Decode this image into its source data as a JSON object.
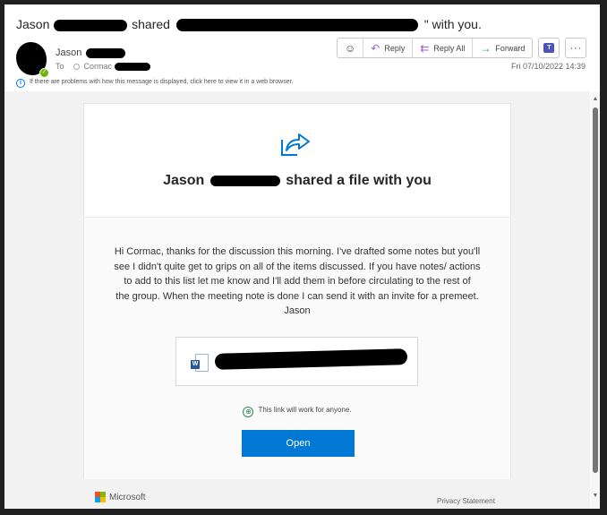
{
  "email": {
    "subject_prefix": "Jason",
    "subject_mid": "shared",
    "subject_suffix": "\" with you.",
    "sender_name": "Jason",
    "to_label": "To",
    "recipient": "Cormac",
    "info_bar": "If there are problems with how this message is displayed, click here to view it in a web browser.",
    "date": "Fri 07/10/2022 14:39",
    "presence": "available"
  },
  "toolbar": {
    "emoji_icon": "☺",
    "reply_icon": "↶",
    "reply_label": "Reply",
    "reply_all_icon": "⇇",
    "reply_all_label": "Reply All",
    "forward_icon": "→",
    "forward_label": "Forward",
    "teams_icon": "T",
    "more_icon": "···"
  },
  "card": {
    "title_prefix": "Jason",
    "title_suffix": "shared a file with you",
    "message_lines": [
      "Hi Cormac, thanks for the discussion this morning. I've drafted some notes but you'll",
      "see I didn't quite get to grips on all of the items discussed. If you have notes/ actions",
      "to add to this list let me know and I'll add them in before circulating to the rest of",
      "the group. When the meeting note is done I can send it with an invite for a premeet.",
      "Jason"
    ],
    "file_type": "W",
    "link_note": "This link will work for anyone.",
    "open_label": "Open"
  },
  "footer": {
    "brand": "Microsoft",
    "privacy": "Privacy Statement",
    "logo_colors": [
      "#f25022",
      "#7fba00",
      "#00a4ef",
      "#ffb900"
    ]
  },
  "scrollbar": {
    "up": "▲",
    "down": "▼"
  }
}
